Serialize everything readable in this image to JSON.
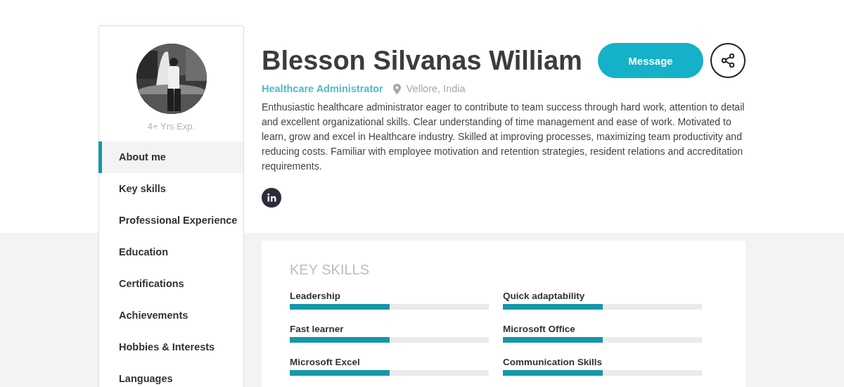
{
  "profile": {
    "experience": "4+ Yrs Exp.",
    "name": "Blesson Silvanas William",
    "title": "Healthcare Administrator",
    "location": "Vellore, India",
    "summary": "Enthusiastic healthcare administrator eager to contribute to team success through hard work, attention to detail and excellent organizational skills. Clear understanding of time management and ease of work. Motivated to learn, grow and excel in Healthcare industry. Skilled at improving processes, maximizing team productivity and reducing costs. Familiar with employee motivation and retention strategies, resident relations and accreditation requirements.",
    "message_button": "Message"
  },
  "sidebar": {
    "items": [
      {
        "label": "About me",
        "selected": true
      },
      {
        "label": "Key skills",
        "selected": false
      },
      {
        "label": "Professional Experience",
        "selected": false
      },
      {
        "label": "Education",
        "selected": false
      },
      {
        "label": "Certifications",
        "selected": false
      },
      {
        "label": "Achievements",
        "selected": false
      },
      {
        "label": "Hobbies & Interests",
        "selected": false
      },
      {
        "label": "Languages",
        "selected": false
      }
    ]
  },
  "key_skills": {
    "heading": "KEY SKILLS",
    "skills": [
      {
        "name": "Leadership",
        "level": 0.5
      },
      {
        "name": "Quick adaptability",
        "level": 0.5
      },
      {
        "name": "Fast learner",
        "level": 0.5
      },
      {
        "name": "Microsoft Office",
        "level": 0.5
      },
      {
        "name": "Microsoft Excel",
        "level": 0.5
      },
      {
        "name": "Communication Skills",
        "level": 0.5
      }
    ]
  }
}
